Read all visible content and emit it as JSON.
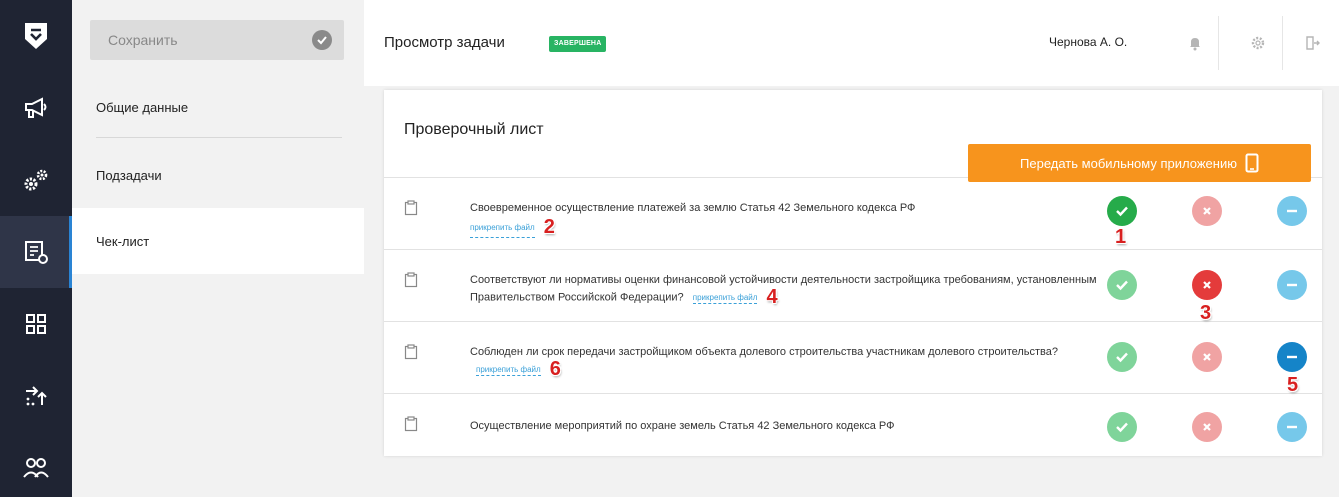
{
  "header": {
    "title": "Просмотр задачи",
    "status": "ЗАВЕРШЕНА",
    "user": "Чернова А. О."
  },
  "left_rail": {
    "items": [
      "logo-icon",
      "megaphone-icon",
      "gears-icon",
      "checklist-icon",
      "apps-grid-icon",
      "transfer-icon",
      "users-icon"
    ],
    "active": "checklist-icon"
  },
  "subnav": {
    "save_label": "Сохранить",
    "items": [
      {
        "label": "Общие данные"
      },
      {
        "label": "Подзадачи"
      },
      {
        "label": "Чек-лист"
      }
    ],
    "active": "Чек-лист"
  },
  "card": {
    "title": "Проверочный лист",
    "mobile_button": "Передать мобильному приложению"
  },
  "checklist": {
    "attach_label": "прикрепить файл",
    "rows": [
      {
        "text": "Своевременное осуществление платежей за землю Статья 42 Земельного кодекса РФ",
        "selected": "yes",
        "has_attach": true,
        "attach_marker": "2",
        "status_marker": "1"
      },
      {
        "text": "Соответствуют ли нормативы оценки финансовой устойчивости деятельности застройщика требованиям, установленным Правительством Российской Федерации?",
        "selected": "no",
        "has_attach": true,
        "attach_marker": "4",
        "status_marker": "3"
      },
      {
        "text": "Соблюден ли срок передачи застройщиком объекта долевого строительства участникам долевого строительства?",
        "selected": "na",
        "has_attach": true,
        "attach_marker": "6",
        "status_marker": "5"
      },
      {
        "text": "Осуществление мероприятий по охране земель Статья 42 Земельного кодекса РФ",
        "selected": "none",
        "has_attach": false
      }
    ]
  },
  "colors": {
    "sidebar": "#1f2433",
    "accent_orange": "#f7941d",
    "status_green": "#28b463",
    "ok_green": "#26ab4a",
    "reject_red": "#e43b3b",
    "na_blue": "#1584c8",
    "annotation_red": "#d82020"
  }
}
